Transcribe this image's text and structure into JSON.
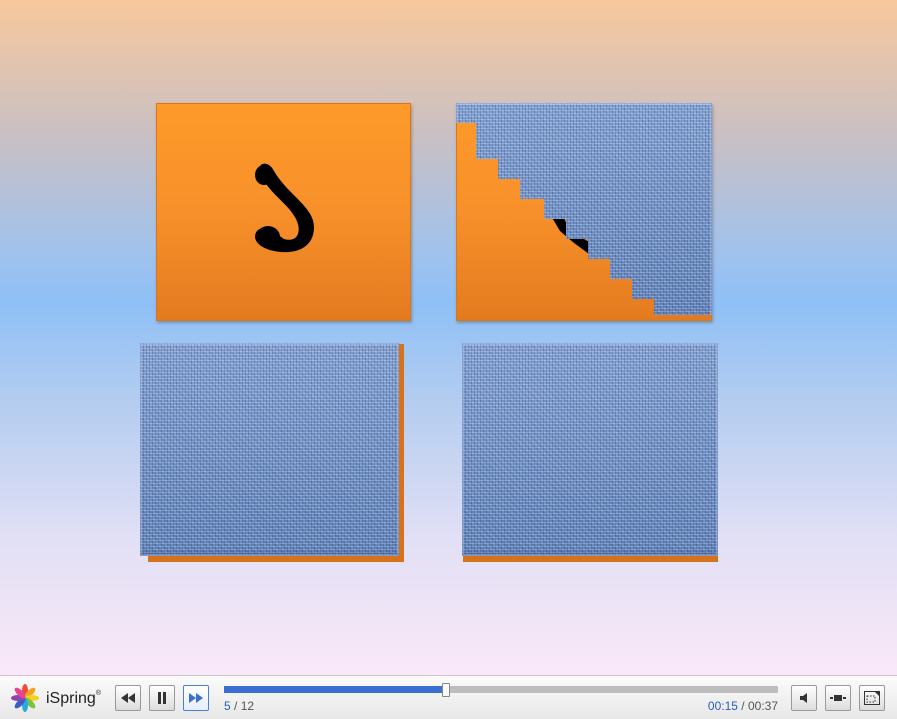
{
  "slide": {
    "letter_tile_glyph": "letter-dal",
    "tiles": [
      {
        "state": "revealed"
      },
      {
        "state": "partially-revealed"
      },
      {
        "state": "covered"
      },
      {
        "state": "covered"
      }
    ]
  },
  "player": {
    "logo_text": "iSpring",
    "logo_mark": "®",
    "slide_current": "5",
    "slide_separator": " / ",
    "slide_total": "12",
    "time_current": "00:15",
    "time_separator": " / ",
    "time_total": "00:37",
    "progress": 0.4,
    "accent_color": "#3a6fd1"
  }
}
